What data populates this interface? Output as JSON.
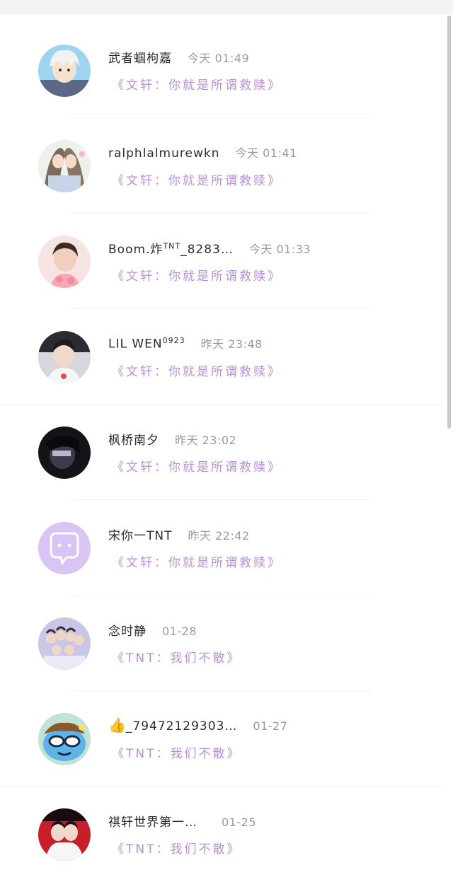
{
  "messages": [
    {
      "username": "武者蝈枸嘉",
      "sup": "",
      "time": "今天 01:49",
      "subtitle": "《文轩：你就是所谓救赎》",
      "avatar": "anime-boy"
    },
    {
      "username": "ralphlalmurewkn",
      "sup": "",
      "time": "今天 01:41",
      "subtitle": "《文轩：你就是所谓救赎》",
      "avatar": "anime-pair"
    },
    {
      "username": "Boom.炸",
      "sup": "TNT",
      "suffix": "_8283…",
      "time": "今天 01:33",
      "subtitle": "《文轩：你就是所谓救赎》",
      "avatar": "pink-photo"
    },
    {
      "username": "LIL WEN",
      "sup": "0923",
      "time": "昨天 23:48",
      "subtitle": "《文轩：你就是所谓救赎》",
      "avatar": "boy-photo"
    },
    {
      "username": "枫桥南夕",
      "sup": "",
      "time": "昨天 23:02",
      "subtitle": "《文轩：你就是所谓救赎》",
      "avatar": "dark-photo"
    },
    {
      "username": "宋你一TNT",
      "sup": "",
      "time": "昨天 22:42",
      "subtitle": "《文轩：你就是所谓救赎》",
      "avatar": "default-chat"
    },
    {
      "username": "念时静",
      "sup": "",
      "time": "01-28",
      "subtitle": "《TNT：我们不散》",
      "avatar": "group-photo"
    },
    {
      "username": "_79472129303…",
      "sup": "",
      "time": "01-27",
      "subtitle": "《TNT：我们不散》",
      "avatar": "cartoon-face",
      "prefix_icon": "thumbs-up"
    },
    {
      "username": "祺轩世界第一…",
      "sup": "",
      "time": "01-25",
      "subtitle": "《TNT：我们不散》",
      "avatar": "red-photo"
    }
  ]
}
